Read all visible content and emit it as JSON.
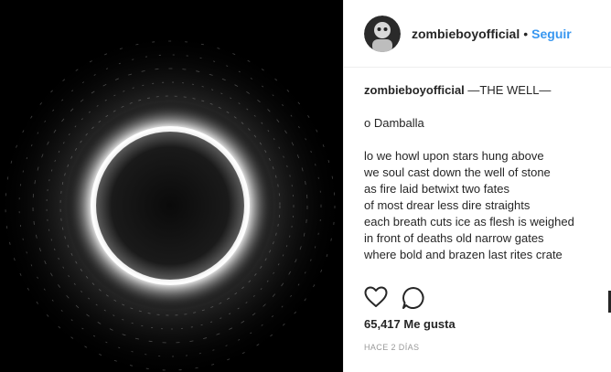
{
  "header": {
    "username": "zombieboyofficial",
    "separator": "•",
    "follow_label": "Seguir"
  },
  "caption": {
    "username": "zombieboyofficial",
    "title": "—THE WELL—",
    "greeting": "o Damballa",
    "lines": [
      "lo we howl upon stars hung above",
      "we soul cast down the well of stone",
      "as fire laid betwixt two fates",
      "of most drear less dire straights",
      "each breath cuts ice as flesh is weighed",
      "in front of deaths old narrow gates",
      "where bold and brazen last rites crate"
    ]
  },
  "stats": {
    "likes": "65,417 Me gusta",
    "time": "HACE 2 DÍAS"
  },
  "colors": {
    "link": "#3897f0",
    "text": "#262626",
    "muted": "#999999",
    "media_bg": "#000000"
  },
  "icons": {
    "like": "heart-icon",
    "comment": "comment-icon"
  }
}
